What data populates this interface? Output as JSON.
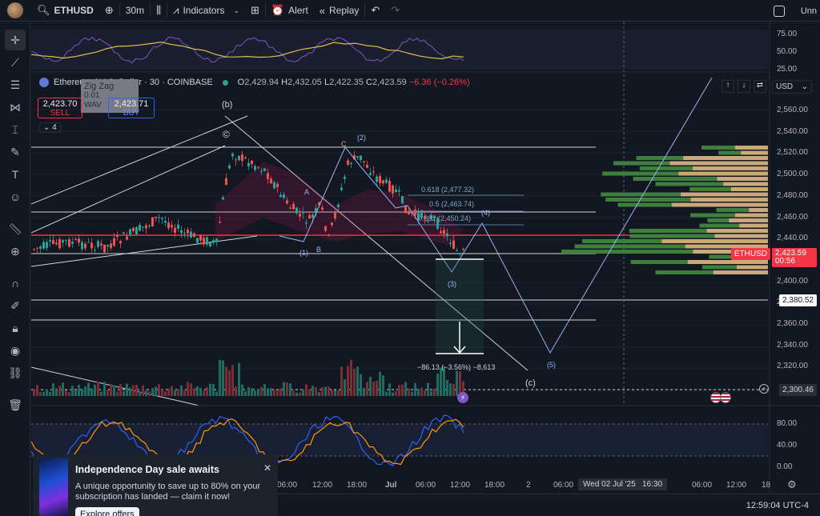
{
  "topbar": {
    "symbol": "ETHUSD",
    "interval": "30m",
    "indicators": "Indicators",
    "alert": "Alert",
    "replay": "Replay",
    "user_text": "Unn"
  },
  "legend": {
    "title": "Ethereum / U.S. Dollar · 30 · COINBASE",
    "o_label": "O",
    "o": "2,429.94",
    "h_label": "H",
    "h": "2,432.05",
    "l_label": "L",
    "l": "2,422.35",
    "c_label": "C",
    "c": "2,423.59",
    "change": "−6.36 (−0.26%)",
    "count": "4"
  },
  "trade": {
    "sell_price": "2,423.70",
    "sell_label": "SELL",
    "buy_price": "2,423.71",
    "buy_label": "BUY",
    "zigzag_label": "Zig Zag",
    "zigzag_sub": "WAV",
    "zigzag_val": "0.01"
  },
  "price_axis": {
    "currency": "USD",
    "ticks": [
      "2,560.00",
      "2,540.00",
      "2,520.00",
      "2,500.00",
      "2,480.00",
      "2,460.00",
      "2,440.00",
      "2,420.00",
      "2,400.00",
      "2,380.00",
      "2,360.00",
      "2,340.00",
      "2,320.00"
    ],
    "osc_top_ticks": [
      "75.00",
      "50.00",
      "25.00"
    ],
    "osc_bottom_ticks": [
      "80.00",
      "40.00",
      "0.00"
    ],
    "last_symbol": "ETHUSD",
    "last_price": "2,423.59",
    "countdown": "00:56",
    "line_2380": "2,380.52",
    "line_2300": "2,300.46"
  },
  "annotations": {
    "wave_b": "(b)",
    "wave_c_circle": "©",
    "wave_c": "(c)",
    "w1": "(1)",
    "w2": "(2)",
    "w3": "(3)",
    "w4": "(4)",
    "w5": "(5)",
    "a": "A",
    "b": "B",
    "c": "C",
    "fib_618": "0.618 (2,477.32)",
    "fib_5": "0.5 (2,463.74)",
    "fib_382": "0.382 (2,450.24)",
    "measure": "−86.13 (−3.56%) −8,613"
  },
  "time_axis": {
    "ticks": [
      "06:00",
      "12:00",
      "18:00",
      "Jul",
      "06:00",
      "12:00",
      "18:00",
      "2",
      "06:00",
      "06:00",
      "12:00",
      "18"
    ],
    "crosshair": "Wed 02 Jul '25   16:30"
  },
  "status": {
    "clock": "12:59:04 UTC-4"
  },
  "promo": {
    "title": "Independence Day sale awaits",
    "body": "A unique opportunity to save up to 80% on your subscription has landed — claim it now!",
    "cta": "Explore offers"
  },
  "colors": {
    "bg": "#131722",
    "up": "#26a69a",
    "down": "#ef5350",
    "accent": "#2962ff",
    "price_line": "#f23645"
  }
}
